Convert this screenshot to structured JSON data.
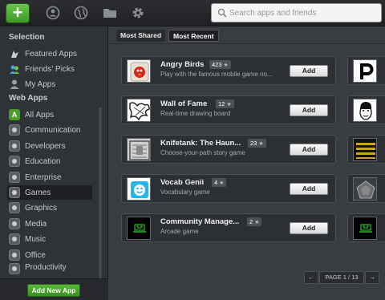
{
  "toolbar": {
    "icons": [
      "plus-icon",
      "user-circle-icon",
      "globe-icon",
      "folder-icon",
      "gear-icon"
    ]
  },
  "search": {
    "placeholder": "Search apps and friends"
  },
  "sidebar": {
    "selection_header": "Selection",
    "selection_items": [
      {
        "label": "Featured Apps",
        "icon": "featured-icon"
      },
      {
        "label": "Friends' Picks",
        "icon": "friends-icon"
      },
      {
        "label": "My Apps",
        "icon": "person-icon"
      }
    ],
    "webapps_header": "Web Apps",
    "webapps_items": [
      {
        "label": "All Apps"
      },
      {
        "label": "Communication"
      },
      {
        "label": "Developers"
      },
      {
        "label": "Education"
      },
      {
        "label": "Enterprise"
      },
      {
        "label": "Games"
      },
      {
        "label": "Graphics"
      },
      {
        "label": "Media"
      },
      {
        "label": "Music"
      },
      {
        "label": "Office"
      },
      {
        "label": "Productivity"
      }
    ],
    "active_item": "Games",
    "add_new_label": "Add New App"
  },
  "tabs": [
    {
      "label": "Most Shared"
    },
    {
      "label": "Most Recent"
    }
  ],
  "apps": [
    {
      "title": "Angry Birds",
      "count": "423",
      "subtitle": "Play with the famous mobile game no..."
    },
    {
      "title": "Wall of Fame",
      "count": "12",
      "subtitle": "Real-time drawing board"
    },
    {
      "title": "Knifetank: The Haun...",
      "count": "23",
      "subtitle": "Choose-your-path story game"
    },
    {
      "title": "Vocab Genii",
      "count": "4",
      "subtitle": "Vocabulary game"
    },
    {
      "title": "Community Manage...",
      "count": "2",
      "subtitle": "Arcade game"
    }
  ],
  "add_label": "Add",
  "pager": {
    "prev": "←",
    "page_label": "PAGE 1 / 13",
    "next": "→"
  }
}
